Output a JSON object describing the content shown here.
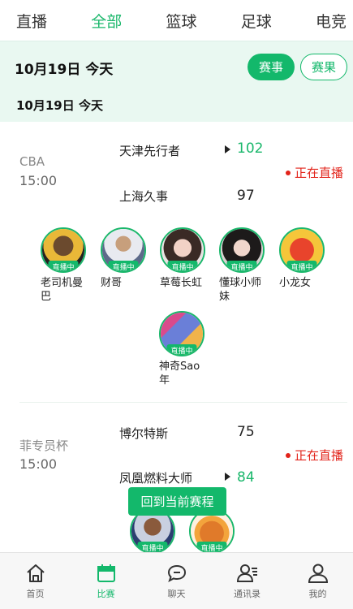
{
  "top_tabs": [
    {
      "label": "直播",
      "active": false
    },
    {
      "label": "全部",
      "active": true
    },
    {
      "label": "篮球",
      "active": false
    },
    {
      "label": "足球",
      "active": false
    },
    {
      "label": "电竞",
      "active": false
    }
  ],
  "header": {
    "date_main": "10月19日  今天",
    "date_sub": "10月19日  今天",
    "schedule_button": "赛事",
    "result_button": "赛果"
  },
  "matches": [
    {
      "league": "CBA",
      "time": "15:00",
      "home": "天津先行者",
      "home_score": "102",
      "away": "上海久事",
      "away_score": "97",
      "status": "正在直播",
      "streamers": [
        {
          "name": "老司机曼巴",
          "badge": "直播中"
        },
        {
          "name": "财哥",
          "badge": "直播中"
        },
        {
          "name": "草莓长虹",
          "badge": "直播中"
        },
        {
          "name": "懂球小师妹",
          "badge": "直播中"
        },
        {
          "name": "小龙女",
          "badge": "直播中"
        },
        {
          "name": "神奇Sao年",
          "badge": "直播中"
        }
      ]
    },
    {
      "league": "菲专员杯",
      "time": "15:00",
      "home": "博尔特斯",
      "home_score": "75",
      "away": "凤凰燃料大师",
      "away_score": "84",
      "status": "正在直播",
      "streamers": [
        {
          "name": "",
          "badge": "直播中"
        },
        {
          "name": "",
          "badge": "直播中"
        }
      ]
    }
  ],
  "return_button": "回到当前赛程",
  "bottom_nav": [
    {
      "label": "首页",
      "icon": "home-icon",
      "active": false
    },
    {
      "label": "比赛",
      "icon": "calendar-icon",
      "active": true
    },
    {
      "label": "聊天",
      "icon": "chat-icon",
      "active": false
    },
    {
      "label": "通讯录",
      "icon": "contacts-icon",
      "active": false
    },
    {
      "label": "我的",
      "icon": "profile-icon",
      "active": false
    }
  ],
  "colors": {
    "accent": "#13b86b",
    "live": "#e2231a",
    "band": "#e9f8f1"
  }
}
